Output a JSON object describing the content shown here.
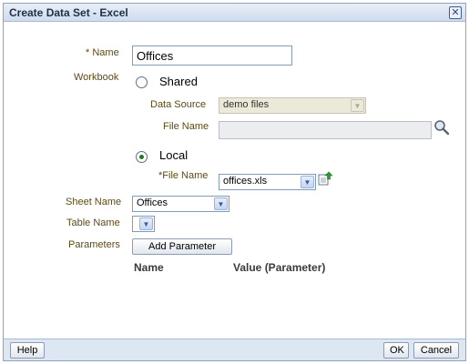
{
  "dialog": {
    "title": "Create Data Set - Excel",
    "close_icon": "close-x-icon"
  },
  "form": {
    "name": {
      "label": "Name",
      "required_mark": "*",
      "value": "Offices"
    },
    "workbook_label": "Workbook",
    "shared": {
      "label": "Shared",
      "selected": false,
      "data_source": {
        "label": "Data Source",
        "value": "demo files"
      },
      "file_name": {
        "label": "File Name",
        "value": "",
        "search_icon": "magnifier-icon"
      }
    },
    "local": {
      "label": "Local",
      "selected": true,
      "file_name": {
        "label": "File Name",
        "required_mark": "*",
        "value": "offices.xls",
        "upload_icon": "upload-icon"
      }
    },
    "sheet_name": {
      "label": "Sheet Name",
      "value": "Offices"
    },
    "table_name": {
      "label": "Table Name",
      "value": ""
    },
    "parameters": {
      "label": "Parameters",
      "add_button": "Add Parameter",
      "columns": [
        "Name",
        "Value (Parameter)"
      ]
    }
  },
  "footer": {
    "help_button": "Help",
    "ok_button": "OK",
    "cancel_button": "Cancel"
  },
  "colors": {
    "label": "#5c4a13",
    "title_bar": "#cfdced",
    "footer": "#dde7f3",
    "radio_selected": "#1e7b1e"
  }
}
